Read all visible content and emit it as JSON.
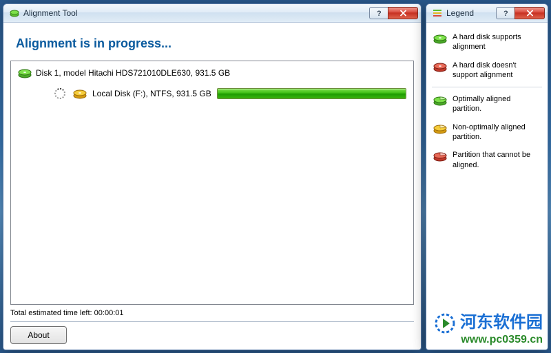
{
  "main": {
    "title": "Alignment Tool",
    "heading": "Alignment is in progress...",
    "disk_label": "Disk 1, model Hitachi HDS721010DLE630, 931.5 GB",
    "partition_label": "Local Disk (F:), NTFS, 931.5 GB",
    "status_prefix": "Total estimated time left: ",
    "status_time": "00:00:01",
    "about_label": "About"
  },
  "legend": {
    "title": "Legend",
    "items": [
      "A hard disk supports alignment",
      "A hard disk doesn't support alignment",
      "Optimally aligned partition.",
      "Non-optimally aligned partition.",
      "Partition that cannot be aligned."
    ]
  },
  "icons": {
    "disk_green": "#5bbf2f",
    "disk_red": "#d9483b",
    "disk_yellow": "#e6b81f"
  },
  "watermark": {
    "cn": "河东软件园",
    "url": "www.pc0359.cn"
  }
}
